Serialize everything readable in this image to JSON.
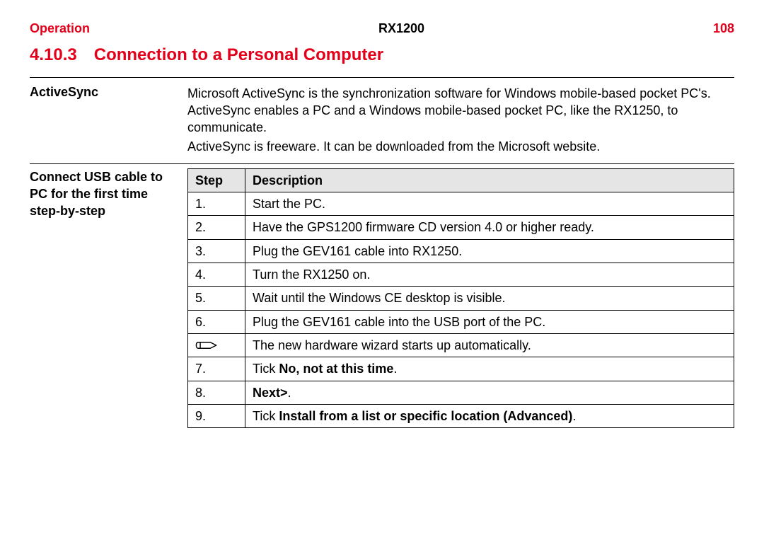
{
  "header": {
    "left": "Operation",
    "center": "RX1200",
    "right": "108"
  },
  "section": {
    "number": "4.10.3",
    "title": "Connection to a Personal Computer"
  },
  "activesync": {
    "label": "ActiveSync",
    "p1": "Microsoft ActiveSync is the synchronization software for Windows mobile-based pocket PC's. ActiveSync enables a PC and a Windows mobile-based pocket PC, like the RX1250, to communicate.",
    "p2": "ActiveSync is freeware. It can be downloaded from the Microsoft website."
  },
  "steps": {
    "label": "Connect USB cable to PC for the first time\nstep-by-step",
    "headers": {
      "step": "Step",
      "desc": "Description"
    },
    "rows": [
      {
        "step": "1.",
        "chunks": [
          {
            "t": "Start the PC."
          }
        ]
      },
      {
        "step": "2.",
        "chunks": [
          {
            "t": "Have the GPS1200 firmware CD version 4.0 or higher ready."
          }
        ]
      },
      {
        "step": "3.",
        "chunks": [
          {
            "t": "Plug the GEV161 cable into RX1250."
          }
        ]
      },
      {
        "step": "4.",
        "chunks": [
          {
            "t": "Turn the RX1250 on."
          }
        ]
      },
      {
        "step": "5.",
        "chunks": [
          {
            "t": "Wait until the Windows CE desktop is visible."
          }
        ]
      },
      {
        "step": "6.",
        "chunks": [
          {
            "t": "Plug the GEV161 cable into the USB port of the PC."
          }
        ]
      },
      {
        "step": "hand",
        "chunks": [
          {
            "t": "The new hardware wizard starts up automatically."
          }
        ]
      },
      {
        "step": "7.",
        "chunks": [
          {
            "t": "Tick "
          },
          {
            "t": "No, not at this time",
            "b": true
          },
          {
            "t": "."
          }
        ]
      },
      {
        "step": "8.",
        "chunks": [
          {
            "t": "Next>",
            "b": true
          },
          {
            "t": "."
          }
        ]
      },
      {
        "step": "9.",
        "chunks": [
          {
            "t": "Tick "
          },
          {
            "t": "Install from a list or specific location (Advanced)",
            "b": true
          },
          {
            "t": "."
          }
        ]
      }
    ]
  }
}
